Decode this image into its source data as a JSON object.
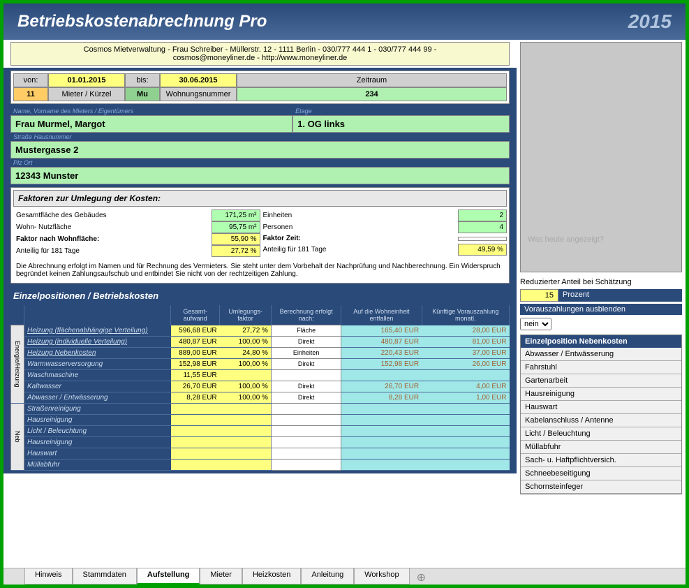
{
  "header": {
    "title": "Betriebskostenabrechnung Pro",
    "year": "2015"
  },
  "info_lines": [
    "Cosmos Mietverwaltung - Frau Schreiber - Müllerstr. 12 - 1111 Berlin - 030/777 444 1 - 030/777 444 99 -",
    "cosmos@moneyliner.de - http://www.moneyliner.de"
  ],
  "period": {
    "von": "von:",
    "date_from": "01.01.2015",
    "bis": "bis:",
    "date_to": "30.06.2015",
    "zeitraum": "Zeitraum",
    "mieter_no": "11",
    "mieter_lbl": "Mieter / Kürzel",
    "kurz": "Mu",
    "wohn_lbl": "Wohnungsnummer",
    "wohn_no": "234"
  },
  "tenant": {
    "name_lbl": "Name, Vorname des Mieters / Eigentümers",
    "name": "Frau Murmel, Margot",
    "etage_lbl": "Etage",
    "etage": "1. OG links",
    "strasse_lbl": "Straße Hausnummer",
    "strasse": "Mustergasse 2",
    "plz_lbl": "Plz Ort",
    "plz": "12343 Munster"
  },
  "factors": {
    "title": "Faktoren zur Umlegung der Kosten:",
    "left": [
      {
        "l": "Gesamtfläche des Gebäudes",
        "v": "171,25 m²",
        "c": "green"
      },
      {
        "l": "Wohn- Nutzfläche",
        "v": "95,75 m²",
        "c": "green"
      },
      {
        "l": "Faktor nach Wohnfläche:",
        "v": "55,90 %",
        "c": "yellow",
        "b": true
      },
      {
        "l": "Anteilig für 181 Tage",
        "v": "27,72 %",
        "c": "yellow"
      }
    ],
    "right": [
      {
        "l": "Einheiten",
        "v": "2",
        "c": "green"
      },
      {
        "l": "Personen",
        "v": "4",
        "c": "green"
      },
      {
        "l": "Faktor Zeit:",
        "v": "",
        "c": "",
        "b": true
      },
      {
        "l": "Anteilig für 181 Tage",
        "v": "49,59 %",
        "c": "yellow"
      }
    ]
  },
  "disclaimer": "Die Abrechnung erfolgt im Namen und für Rechnung des Vermieters. Sie steht unter dem Vorbehalt der Nachprüfung und Nachberechnung. Ein Widerspruch begründet keinen Zahlungsaufschub und entbindet Sie nicht von der rechtzeitigen Zahlung.",
  "costs": {
    "title": "Einzelpositionen / Betriebskosten",
    "cols": [
      "Gesamt-aufwand",
      "Umlegungs-faktor",
      "Berechnung erfolgt nach:",
      "Auf die Wohneinheit entfallen",
      "Künftige Vorauszahlung monatl."
    ],
    "groups": [
      {
        "cat": "Energie/Heizung",
        "rows": [
          {
            "n": "Heizung (flächenabhängige Verteilung)",
            "a": "596,68 EUR",
            "f": "27,72 %",
            "c": "Fläche",
            "e": "165,40 EUR",
            "v": "28,00 EUR"
          },
          {
            "n": "Heizung (individuelle Verteilung)",
            "a": "480,87 EUR",
            "f": "100,00 %",
            "c": "Direkt",
            "e": "480,87 EUR",
            "v": "81,00 EUR"
          },
          {
            "n": "Heizung Nebenkosten",
            "a": "889,00 EUR",
            "f": "24,80 %",
            "c": "Einheiten",
            "e": "220,43 EUR",
            "v": "37,00 EUR"
          },
          {
            "n": "Warmwasserversorgung",
            "a": "152,98 EUR",
            "f": "100,00 %",
            "c": "Direkt",
            "e": "152,98 EUR",
            "v": "26,00 EUR"
          },
          {
            "n": "Waschmaschine",
            "a": "11,55 EUR",
            "f": "",
            "c": "",
            "e": "",
            "v": ""
          },
          {
            "n": "Kaltwasser",
            "a": "26,70 EUR",
            "f": "100,00 %",
            "c": "Direkt",
            "e": "26,70 EUR",
            "v": "4,00 EUR"
          },
          {
            "n": "Abwasser / Entwässerung",
            "a": "8,28 EUR",
            "f": "100,00 %",
            "c": "Direkt",
            "e": "8,28 EUR",
            "v": "1,00 EUR"
          }
        ]
      },
      {
        "cat": "Neb",
        "rows": [
          {
            "n": "Straßenreinigung",
            "a": "",
            "f": "",
            "c": "",
            "e": "",
            "v": ""
          },
          {
            "n": "Hausreinigung",
            "a": "",
            "f": "",
            "c": "",
            "e": "",
            "v": ""
          },
          {
            "n": "Licht / Beleuchtung",
            "a": "",
            "f": "",
            "c": "",
            "e": "",
            "v": ""
          },
          {
            "n": "Hausreinigung",
            "a": "",
            "f": "",
            "c": "",
            "e": "",
            "v": ""
          },
          {
            "n": "Hauswart",
            "a": "",
            "f": "",
            "c": "",
            "e": "",
            "v": ""
          },
          {
            "n": "Müllabfuhr",
            "a": "",
            "f": "",
            "c": "",
            "e": "",
            "v": ""
          }
        ]
      }
    ]
  },
  "right": {
    "sidebar_faded": "Was heute angezeigt?",
    "red_lbl": "Reduzierter Anteil bei Schätzung",
    "prozent_val": "15",
    "prozent_lbl": "Prozent",
    "voraus_lbl": "Vorauszahlungen ausblenden",
    "voraus_opt": "nein",
    "list_head": "Einzelposition Nebenkosten",
    "list": [
      "Abwasser / Entwässerung",
      "Fahrstuhl",
      "Gartenarbeit",
      "Hausreinigung",
      "Hauswart",
      "Kabelanschluss / Antenne",
      "Licht / Beleuchtung",
      "Müllabfuhr",
      "Sach- u. Haftpflichtversich.",
      "Schneebeseitigung",
      "Schornsteinfeger"
    ]
  },
  "tabs": [
    "Hinweis",
    "Stammdaten",
    "Aufstellung",
    "Mieter",
    "Heizkosten",
    "Anleitung",
    "Workshop"
  ],
  "active_tab": 2
}
